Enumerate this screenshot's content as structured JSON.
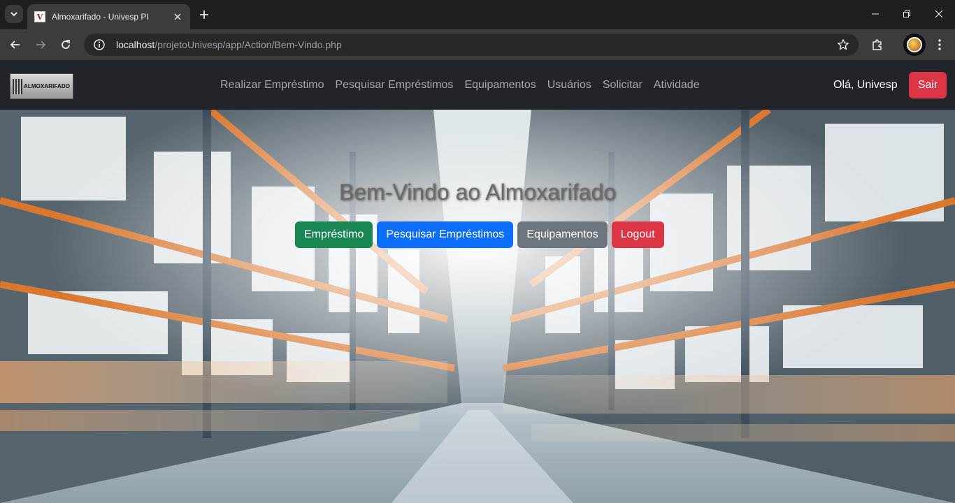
{
  "browser": {
    "tab_title": "Almoxarifado - Univesp PI",
    "favicon_letter": "V",
    "url_host": "localhost",
    "url_path": "/projetoUnivesp/app/Action/Bem-Vindo.php"
  },
  "navbar": {
    "logo_text": "ALMOXARIFADO",
    "links": [
      "Realizar Empréstimo",
      "Pesquisar Empréstimos",
      "Equipamentos",
      "Usuários",
      "Solicitar",
      "Atividade"
    ],
    "greeting": "Olá, Univesp",
    "logout_label": "Sair"
  },
  "hero": {
    "title": "Bem-Vindo ao Almoxarifado",
    "buttons": {
      "emprestimo": "Empréstimo",
      "pesquisar": "Pesquisar Empréstimos",
      "equipamentos": "Equipamentos",
      "logout": "Logout"
    }
  },
  "colors": {
    "navbar_bg": "#212529",
    "success": "#198754",
    "primary": "#0d6efd",
    "secondary": "#6c757d",
    "danger": "#dc3545"
  },
  "icons": [
    "tab-search-icon",
    "close-icon",
    "plus-icon",
    "minimize-icon",
    "maximize-icon",
    "window-close-icon",
    "back-icon",
    "forward-icon",
    "reload-icon",
    "site-info-icon",
    "star-icon",
    "extensions-icon",
    "kebab-menu-icon"
  ]
}
